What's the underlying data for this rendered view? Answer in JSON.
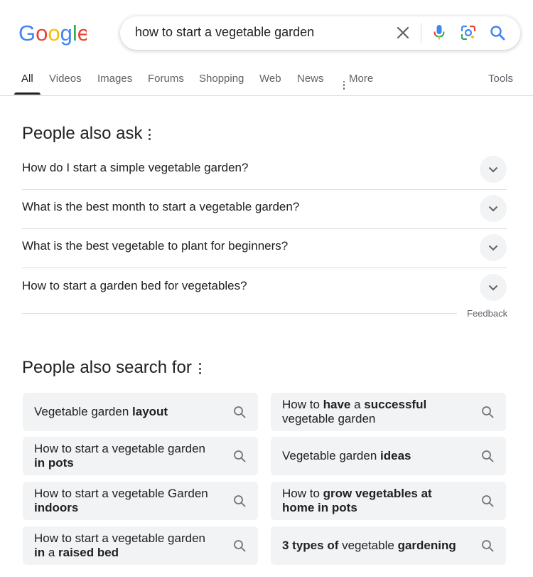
{
  "logo": {
    "letters": [
      "G",
      "o",
      "o",
      "g",
      "l",
      "e"
    ],
    "colors": [
      "#4285F4",
      "#EA4335",
      "#FBBC05",
      "#4285F4",
      "#34A853",
      "#EA4335"
    ]
  },
  "search": {
    "query": "how to start a vegetable garden",
    "icons": [
      "clear-icon",
      "microphone-icon",
      "lens-icon",
      "search-icon"
    ]
  },
  "tabs": [
    {
      "label": "All",
      "active": true
    },
    {
      "label": "Videos"
    },
    {
      "label": "Images"
    },
    {
      "label": "Forums"
    },
    {
      "label": "Shopping"
    },
    {
      "label": "Web"
    },
    {
      "label": "News"
    },
    {
      "label": "More",
      "icon": "kebab-icon"
    },
    {
      "label": "Tools"
    }
  ],
  "people_also_ask": {
    "title": "People also ask",
    "questions": [
      "How do I start a simple vegetable garden?",
      "What is the best month to start a vegetable garden?",
      "What is the best vegetable to plant for beginners?",
      "How to start a garden bed for vegetables?"
    ],
    "feedback": "Feedback"
  },
  "people_also_search": {
    "title": "People also search for",
    "chips": [
      [
        {
          "t": "Vegetable garden "
        },
        {
          "t": "layout",
          "b": true
        }
      ],
      [
        {
          "t": "How to "
        },
        {
          "t": "have",
          "b": true
        },
        {
          "t": " a "
        },
        {
          "t": "successful",
          "b": true
        },
        {
          "t": " vegetable garden"
        }
      ],
      [
        {
          "t": "How to start a vegetable garden "
        },
        {
          "t": "in pots",
          "b": true
        }
      ],
      [
        {
          "t": "Vegetable garden "
        },
        {
          "t": "ideas",
          "b": true
        }
      ],
      [
        {
          "t": "How to start a vegetable Garden "
        },
        {
          "t": "indoors",
          "b": true
        }
      ],
      [
        {
          "t": "How to "
        },
        {
          "t": "grow vegetables at home in pots",
          "b": true
        }
      ],
      [
        {
          "t": "How to start a vegetable garden "
        },
        {
          "t": "in",
          "b": true
        },
        {
          "t": " a "
        },
        {
          "t": "raised bed",
          "b": true
        }
      ],
      [
        {
          "t": "3 types",
          "b": true
        },
        {
          "t": " "
        },
        {
          "t": "of",
          "b": true
        },
        {
          "t": " vegetable "
        },
        {
          "t": "gardening",
          "b": true
        }
      ]
    ]
  }
}
